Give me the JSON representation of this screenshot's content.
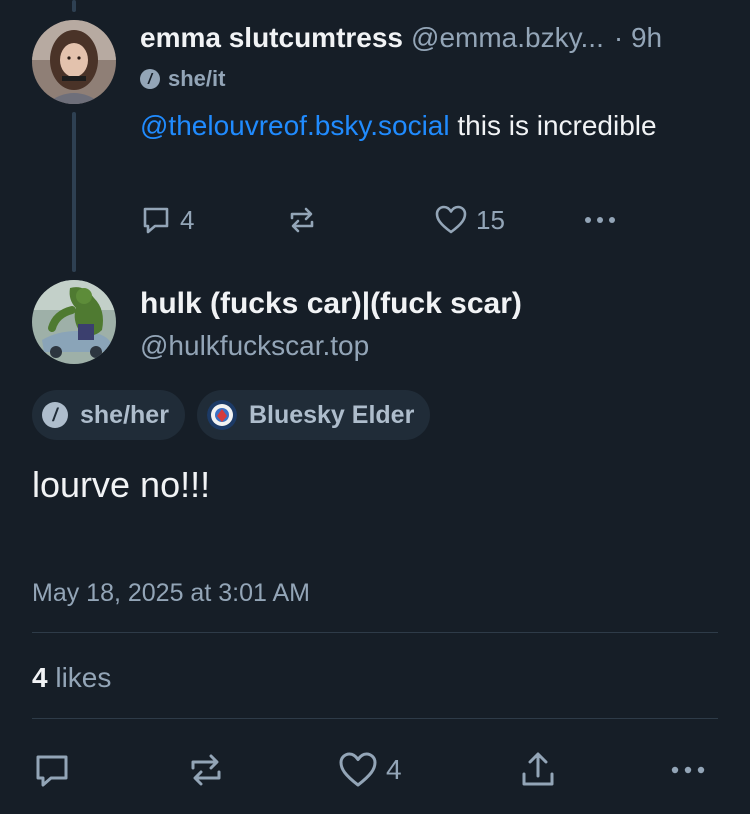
{
  "parent_post": {
    "display_name": "emma slutcumtress",
    "handle": "@emma.bzky...",
    "time": "· 9h",
    "pronouns": "she/it",
    "pronoun_icon_glyph": "/",
    "mention": "@thelouvreof.bsky.social",
    "text": " this is incredible",
    "reply_count": "4",
    "like_count": "15"
  },
  "main_post": {
    "display_name": "hulk (fucks car)|(fuck scar)",
    "handle": "@hulkfuckscar.top",
    "badges": {
      "pronouns": "she/her",
      "pronoun_icon_glyph": "/",
      "elder": "Bluesky Elder"
    },
    "text": "lourve no!!!",
    "date": "May 18, 2025 at 3:01 AM",
    "likes_count": "4",
    "likes_label": " likes",
    "action_like_count": "4"
  },
  "colors": {
    "background": "#161e27",
    "text": "#f1f3f5",
    "muted": "#93a5b7",
    "link": "#208bfe",
    "badge_bg": "#202c38"
  },
  "icons": {
    "reply": "reply-icon",
    "repost": "repost-icon",
    "like": "heart-icon",
    "share": "share-icon",
    "more": "more-icon"
  }
}
